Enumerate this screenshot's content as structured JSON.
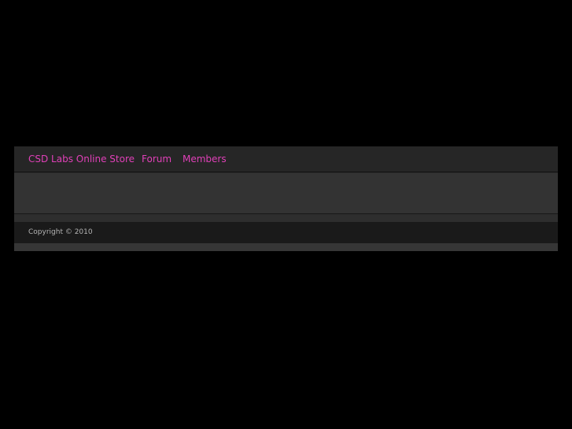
{
  "nav": {
    "items": [
      {
        "label": "CSD Labs Online Store"
      },
      {
        "label": "Forum"
      },
      {
        "label": "Members"
      }
    ]
  },
  "footer": {
    "copyright": "Copyright © 2010"
  },
  "colors": {
    "background": "#000000",
    "nav_link": "#e040b8",
    "navbar": "#262626",
    "content": "#333333",
    "footer": "#1a1a1a"
  }
}
